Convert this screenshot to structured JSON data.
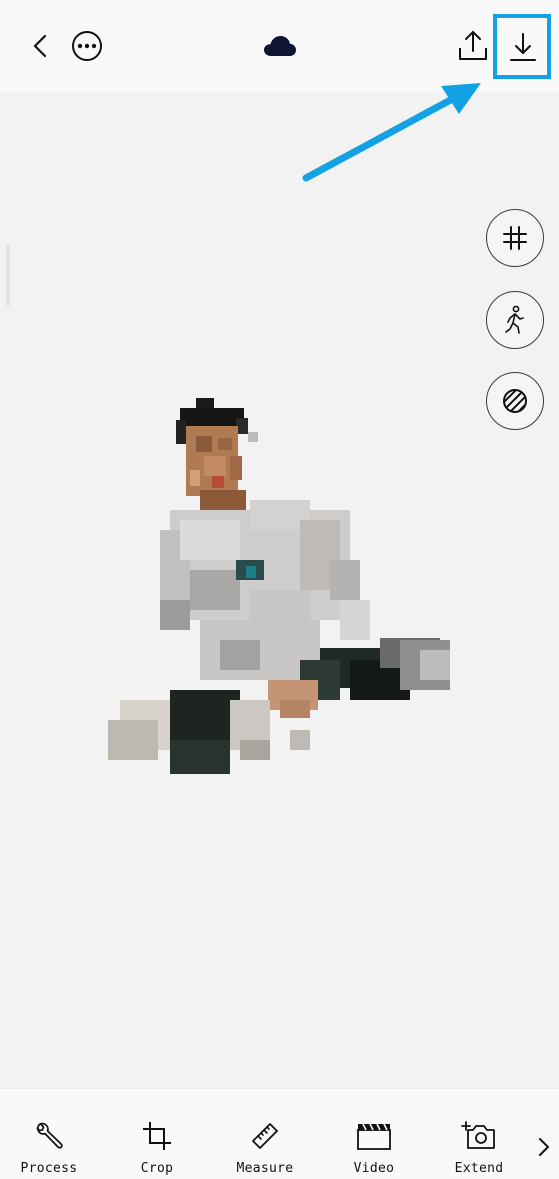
{
  "toolbar": {
    "back_icon": "chevron-left-icon",
    "more_icon": "ellipsis-circle-icon",
    "cloud_icon": "cloud-icon",
    "share_icon": "share-upload-icon",
    "download_icon": "download-icon",
    "highlight_color": "#12a1e3"
  },
  "side_tools": [
    {
      "name": "grid",
      "icon": "grid-hash-icon"
    },
    {
      "name": "pose",
      "icon": "walking-person-icon"
    },
    {
      "name": "pattern",
      "icon": "striped-circle-icon"
    }
  ],
  "bottom_tools": [
    {
      "label": "Process",
      "icon": "wrench-icon"
    },
    {
      "label": "Crop",
      "icon": "crop-icon"
    },
    {
      "label": "Measure",
      "icon": "ruler-icon"
    },
    {
      "label": "Video",
      "icon": "clapperboard-icon"
    },
    {
      "label": "Extend",
      "icon": "camera-plus-icon"
    }
  ],
  "colors": {
    "background": "#f3f2f2",
    "bars": "#faf9f9",
    "annotation_arrow": "#12a1e3"
  }
}
